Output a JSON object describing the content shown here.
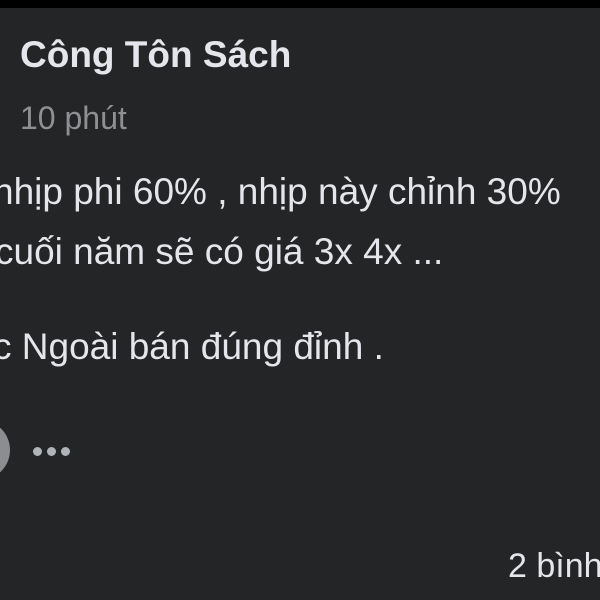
{
  "post": {
    "author": "Công Tôn Sách",
    "time": "10 phút",
    "lines": [
      "nhịp phi 60% , nhịp này chỉnh 30%",
      "cuối năm sẽ có giá 3x 4x ...",
      "c Ngoài bán đúng đỉnh ."
    ],
    "more_icon": "more-horizontal-icon",
    "comment_count": "2 bình"
  }
}
